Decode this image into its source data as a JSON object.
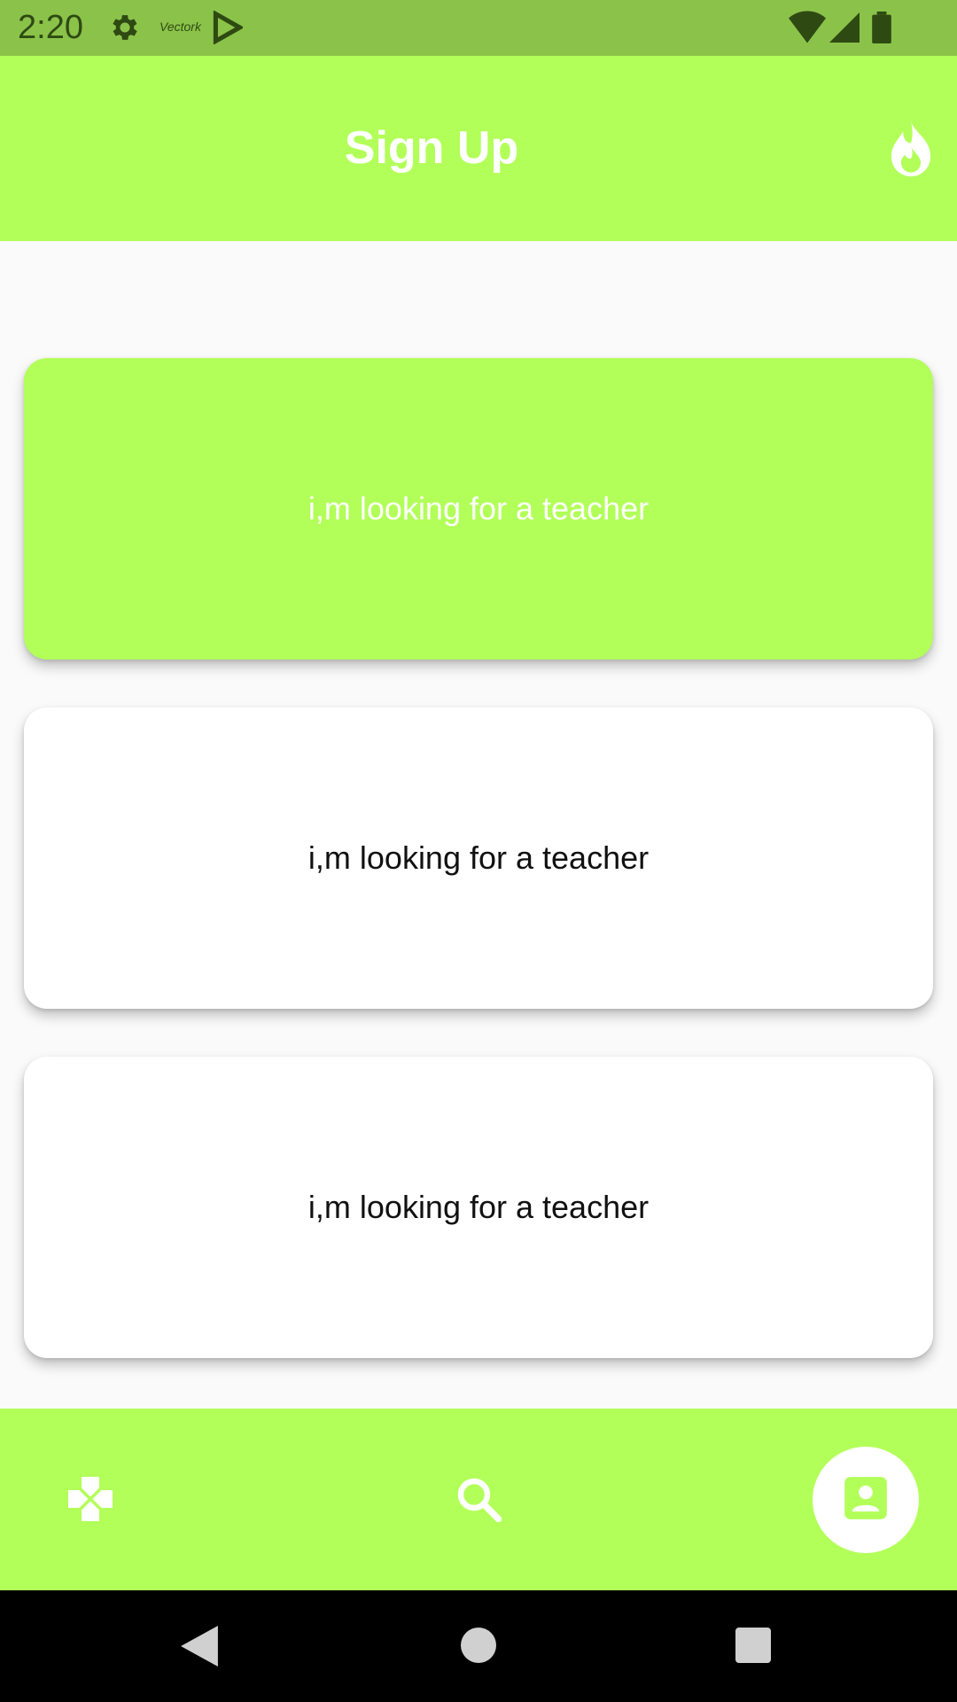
{
  "status_bar": {
    "time": "2:20",
    "icons": [
      "gear-icon",
      "vectork-icon",
      "play-store-icon",
      "wifi-icon",
      "signal-icon",
      "battery-icon"
    ],
    "vectork_text": "Vectork",
    "background": "#8bc34a"
  },
  "app_bar": {
    "title": "Sign Up",
    "action_icon": "flame-icon",
    "background": "#b2ff59"
  },
  "cards": [
    {
      "label": "i,m looking for a teacher",
      "selected": true
    },
    {
      "label": "i,m looking for a teacher",
      "selected": false
    },
    {
      "label": "i,m looking for a teacher",
      "selected": false
    }
  ],
  "bottom_nav": {
    "items": [
      {
        "icon": "gamepad-icon",
        "active": false
      },
      {
        "icon": "search-icon",
        "active": false
      },
      {
        "icon": "contact-icon",
        "active": true
      }
    ],
    "background": "#b2ff59"
  },
  "system_nav": {
    "buttons": [
      "back-icon",
      "home-icon",
      "recents-icon"
    ]
  },
  "colors": {
    "accent": "#b2ff59",
    "status": "#8bc34a",
    "text_on_accent": "#ffffff"
  }
}
